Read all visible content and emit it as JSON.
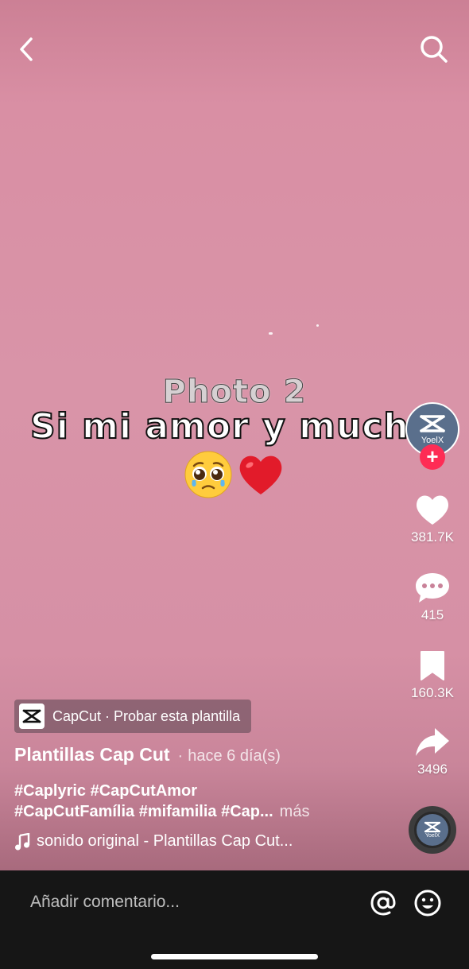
{
  "nav": {
    "back_icon": "chevron-left-icon",
    "search_icon": "search-icon"
  },
  "overlay": {
    "photo_label": "Photo 2",
    "lyric": "Si mi amor y mucho",
    "emojis": [
      "pleading-face-icon",
      "red-heart-icon"
    ]
  },
  "creator": {
    "avatar_name": "YoelX",
    "follow_icon": "plus-icon"
  },
  "actions": {
    "likes": "381.7K",
    "comments": "415",
    "saves": "160.3K",
    "shares": "3496"
  },
  "template_chip": {
    "logo_icon": "capcut-logo-icon",
    "label": "CapCut · Probar esta plantilla"
  },
  "post": {
    "author": "Plantillas Cap Cut",
    "separator": "·",
    "time": "hace 6 día(s)",
    "caption_line1": "#Caplyric #CapCutAmor",
    "caption_line2": "#CapCutFamília #mifamilia #Cap...",
    "more": "más",
    "music": "sonido original - Plantillas Cap Cut..."
  },
  "disc": {
    "name": "YoelX"
  },
  "comment_bar": {
    "placeholder": "Añadir comentario..."
  },
  "colors": {
    "accent": "#fe2c55",
    "background": "#d994a8",
    "bar": "#161616"
  }
}
